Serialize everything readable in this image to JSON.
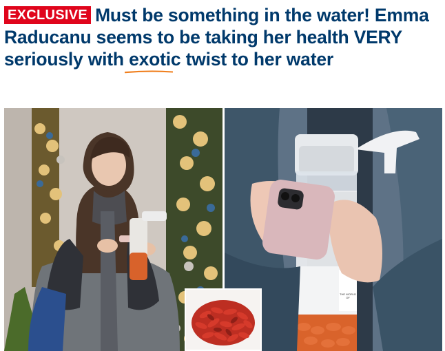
{
  "headline": {
    "badge": "EXCLUSIVE",
    "text_before": "Must be something in the water! Emma Raducanu seems to be taking her health VERY seriously with ",
    "highlight": "exotic twist",
    "text_after": " to her water"
  },
  "colors": {
    "badge_bg": "#e0051c",
    "headline_text": "#00396b",
    "underline": "#f07f1e"
  },
  "photos": {
    "left": {
      "bag_text": ""
    },
    "right": {
      "bottle_label": "THE WORLD OF"
    }
  },
  "icons": {
    "inset": "goji-berries"
  }
}
